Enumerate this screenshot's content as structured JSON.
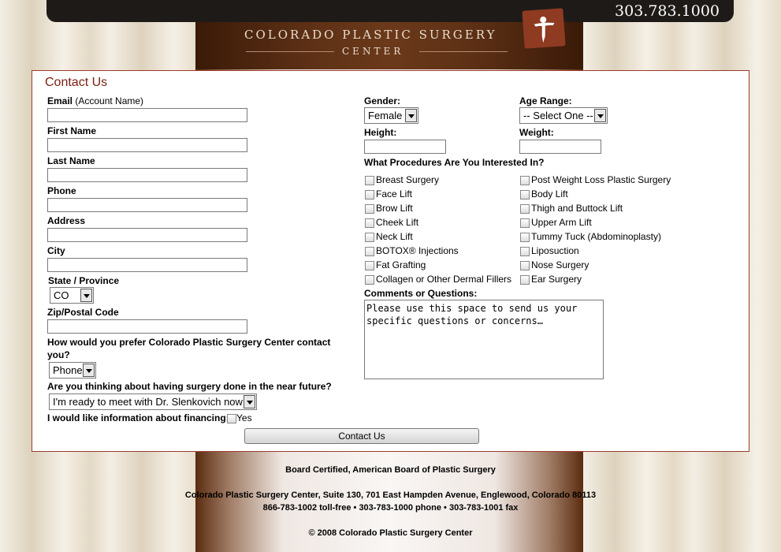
{
  "header": {
    "phone": "303.783.1000",
    "brand_line1": "COLORADO PLASTIC SURGERY",
    "brand_line2": "CENTER",
    "logo_icon": "figure-logo-icon"
  },
  "form": {
    "title": "Contact Us",
    "email_label": "Email",
    "email_hint": "(Account Name)",
    "first_name_label": "First Name",
    "last_name_label": "Last Name",
    "phone_label": "Phone",
    "address_label": "Address",
    "city_label": "City",
    "state_label": "State / Province",
    "state_value": "CO",
    "zip_label": "Zip/Postal Code",
    "contact_pref_label_1": "How would you prefer Colorado Plastic Surgery Center contact",
    "contact_pref_label_2": "you?",
    "contact_pref_value": "Phone",
    "timeline_label": "Are you thinking about having surgery done in the near future?",
    "timeline_value": "I'm ready to meet with Dr. Slenkovich now",
    "financing_label": "I would like information about financing:",
    "financing_option": "Yes",
    "gender_label": "Gender:",
    "gender_value": "Female",
    "age_label": "Age Range:",
    "age_value": "-- Select One --",
    "height_label": "Height:",
    "weight_label": "Weight:",
    "procedures_label": "What Procedures Are You Interested In?",
    "procedures_left": [
      "Breast Surgery",
      "Face Lift",
      "Brow Lift",
      "Cheek Lift",
      "Neck Lift",
      "BOTOX® Injections",
      "Fat Grafting",
      "Collagen or Other Dermal Fillers"
    ],
    "procedures_right": [
      "Post Weight Loss Plastic Surgery",
      "Body Lift",
      "Thigh and Buttock Lift",
      "Upper Arm Lift",
      "Tummy Tuck (Abdominoplasty)",
      "Liposuction",
      "Nose Surgery",
      "Ear Surgery"
    ],
    "comments_label": "Comments or Questions:",
    "comments_value": "Please use this space to send us your\nspecific questions or concerns…",
    "submit_label": "Contact Us"
  },
  "footer": {
    "certification": "Board Certified, American Board of Plastic Surgery",
    "address": "Colorado Plastic Surgery Center, Suite 130, 701 East Hampden Avenue, Englewood, Colorado 80113",
    "phones": "866-783-1002 toll-free • 303-783-1000 phone • 303-783-1001 fax",
    "copyright": "© 2008 Colorado Plastic Surgery Center"
  },
  "colors": {
    "accent": "#7a1e10",
    "border": "#9b3a2a",
    "topbar": "#1e1a18"
  }
}
